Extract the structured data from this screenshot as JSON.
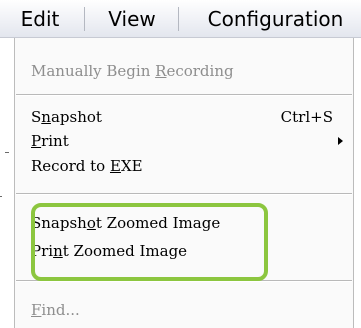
{
  "menubar": {
    "items": [
      {
        "label": "Edit"
      },
      {
        "label": "View"
      },
      {
        "label": "Configuration"
      }
    ]
  },
  "menu": {
    "items": [
      {
        "pre": "Manually Begin ",
        "key": "R",
        "post": "ecording",
        "disabled": true
      },
      {
        "pre": "S",
        "key": "n",
        "post": "apshot",
        "shortcut": "Ctrl+S"
      },
      {
        "pre": "",
        "key": "P",
        "post": "rint",
        "submenu": true
      },
      {
        "pre": "Record to ",
        "key": "E",
        "post": "XE"
      },
      {
        "pre": "Snapsh",
        "key": "o",
        "post": "t Zoomed Image"
      },
      {
        "pre": "Pri",
        "key": "n",
        "post": "t Zoomed Image"
      },
      {
        "pre": "",
        "key": "F",
        "post": "ind...",
        "disabled": true
      }
    ]
  },
  "highlight": {
    "color": "#8cc63f"
  }
}
